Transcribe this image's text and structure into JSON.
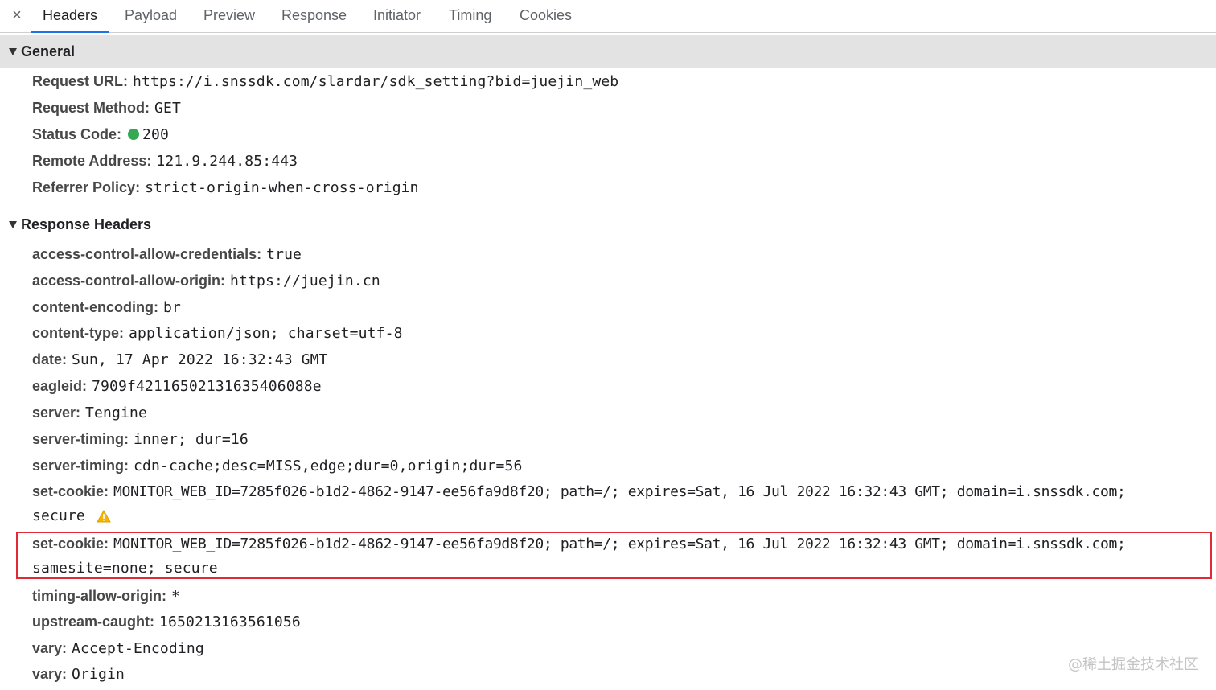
{
  "tabs": {
    "close_glyph": "×",
    "items": [
      "Headers",
      "Payload",
      "Preview",
      "Response",
      "Initiator",
      "Timing",
      "Cookies"
    ],
    "active": "Headers"
  },
  "general": {
    "title": "General",
    "request_url": {
      "key": "Request URL:",
      "value": "https://i.snssdk.com/slardar/sdk_setting?bid=juejin_web"
    },
    "request_method": {
      "key": "Request Method:",
      "value": "GET"
    },
    "status_code": {
      "key": "Status Code:",
      "value": "200",
      "status_color": "#34a853"
    },
    "remote_address": {
      "key": "Remote Address:",
      "value": "121.9.244.85:443"
    },
    "referrer_policy": {
      "key": "Referrer Policy:",
      "value": "strict-origin-when-cross-origin"
    }
  },
  "response_headers": {
    "title": "Response Headers",
    "rows": [
      {
        "key": "access-control-allow-credentials:",
        "value": "true"
      },
      {
        "key": "access-control-allow-origin:",
        "value": "https://juejin.cn"
      },
      {
        "key": "content-encoding:",
        "value": "br"
      },
      {
        "key": "content-type:",
        "value": "application/json; charset=utf-8"
      },
      {
        "key": "date:",
        "value": "Sun, 17 Apr 2022 16:32:43 GMT"
      },
      {
        "key": "eagleid:",
        "value": "7909f42116502131635406088e"
      },
      {
        "key": "server:",
        "value": "Tengine"
      },
      {
        "key": "server-timing:",
        "value": "inner; dur=16"
      },
      {
        "key": "server-timing:",
        "value": "cdn-cache;desc=MISS,edge;dur=0,origin;dur=56"
      },
      {
        "key": "set-cookie:",
        "value": "MONITOR_WEB_ID=7285f026-b1d2-4862-9147-ee56fa9d8f20; path=/; expires=Sat, 16 Jul 2022 16:32:43 GMT; domain=i.snssdk.com;",
        "continuation": "secure"
      },
      {
        "key": "set-cookie:",
        "value": "MONITOR_WEB_ID=7285f026-b1d2-4862-9147-ee56fa9d8f20; path=/; expires=Sat, 16 Jul 2022 16:32:43 GMT; domain=i.snssdk.com;",
        "continuation": "samesite=none; secure"
      },
      {
        "key": "timing-allow-origin:",
        "value": "*"
      },
      {
        "key": "upstream-caught:",
        "value": "1650213163561056"
      },
      {
        "key": "vary:",
        "value": "Accept-Encoding"
      },
      {
        "key": "vary:",
        "value": "Origin"
      }
    ]
  },
  "warning_icon": "warning-triangle-icon",
  "highlight_color": "#e02b36",
  "watermark": "@稀土掘金技术社区"
}
